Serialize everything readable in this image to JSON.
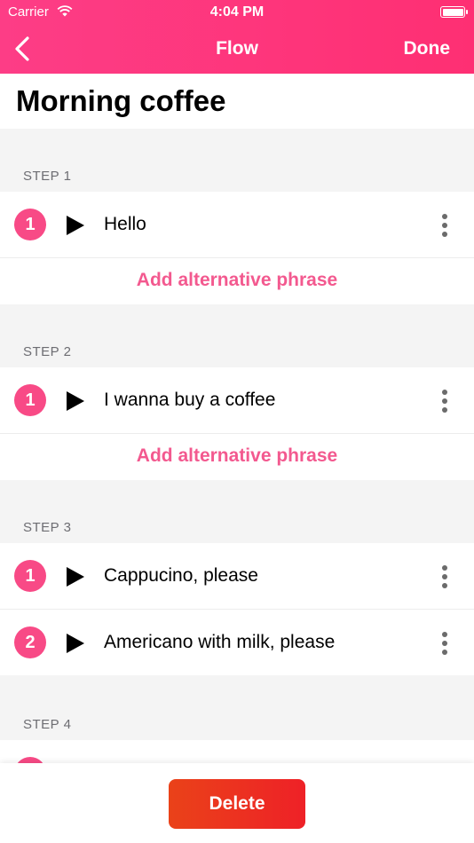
{
  "status_bar": {
    "carrier": "Carrier",
    "time": "4:04 PM"
  },
  "nav": {
    "title": "Flow",
    "done_label": "Done"
  },
  "page_title": "Morning coffee",
  "add_label": "Add alternative phrase",
  "steps": [
    {
      "label": "STEP 1",
      "phrases": [
        {
          "index": "1",
          "text": "Hello"
        }
      ]
    },
    {
      "label": "STEP 2",
      "phrases": [
        {
          "index": "1",
          "text": "I wanna buy a coffee"
        }
      ]
    },
    {
      "label": "STEP 3",
      "phrases": [
        {
          "index": "1",
          "text": "Cappucino, please"
        },
        {
          "index": "2",
          "text": "Americano with milk, please"
        }
      ]
    },
    {
      "label": "STEP 4",
      "phrases": []
    }
  ],
  "delete_label": "Delete",
  "colors": {
    "header": "#fe3579",
    "accent": "#f84a86",
    "delete": "#eb3320"
  }
}
